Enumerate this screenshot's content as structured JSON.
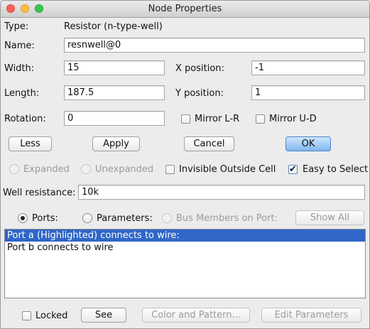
{
  "window": {
    "title": "Node Properties"
  },
  "type": {
    "label": "Type:",
    "value": "Resistor (n-type-well)"
  },
  "name": {
    "label": "Name:",
    "value": "resnwell@0"
  },
  "width": {
    "label": "Width:",
    "value": "15"
  },
  "length": {
    "label": "Length:",
    "value": "187.5"
  },
  "rotation": {
    "label": "Rotation:",
    "value": "0"
  },
  "x_position": {
    "label": "X position:",
    "value": "-1"
  },
  "y_position": {
    "label": "Y position:",
    "value": "1"
  },
  "mirror_lr": {
    "label": "Mirror L-R",
    "checked": false
  },
  "mirror_ud": {
    "label": "Mirror U-D",
    "checked": false
  },
  "buttons": {
    "less": "Less",
    "apply": "Apply",
    "cancel": "Cancel",
    "ok": "OK"
  },
  "options": {
    "expanded": "Expanded",
    "unexpanded": "Unexpanded",
    "invisible_outside_cell": {
      "label": "Invisible Outside Cell",
      "checked": false
    },
    "easy_to_select": {
      "label": "Easy to Select",
      "checked": true
    }
  },
  "well_resistance": {
    "label": "Well resistance:",
    "value": "10k"
  },
  "view_mode": {
    "ports": "Ports:",
    "parameters": "Parameters:",
    "bus_members": "Bus Members on Port:",
    "show_all": "Show All",
    "selected": "Ports"
  },
  "port_list": [
    {
      "text": "Port a (Highlighted) connects to wire:",
      "selected": true
    },
    {
      "text": "Port b connects to wire",
      "selected": false
    }
  ],
  "footer": {
    "locked": {
      "label": "Locked",
      "checked": false
    },
    "see": "See",
    "color_and_pattern": "Color and Pattern...",
    "edit_parameters": "Edit Parameters"
  },
  "colors": {
    "selection": "#2f66c8",
    "default_button": "#7fb6ef",
    "close_light": "#fc605b",
    "minimize_light": "#fdbc40",
    "zoom_light": "#34c84a"
  }
}
